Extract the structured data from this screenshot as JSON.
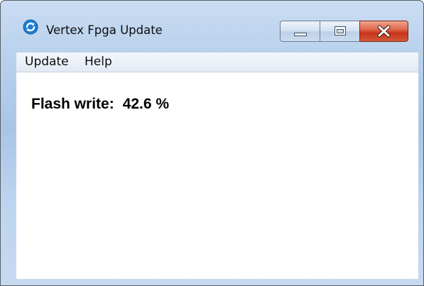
{
  "window": {
    "title": "Vertex Fpga Update",
    "icon": "refresh-circle-icon",
    "controls": {
      "minimize": "minimize-icon",
      "maximize": "maximize-icon",
      "close": "close-icon"
    }
  },
  "menu": {
    "items": [
      {
        "label": "Update"
      },
      {
        "label": "Help"
      }
    ]
  },
  "status": {
    "label": "Flash write:",
    "value": "42.6 %",
    "progress_percent": 42.6
  },
  "colors": {
    "titlebar": "#b9d1ec",
    "close_button": "#c7341a",
    "menubar": "#e3eaf5",
    "client_background": "#ffffff",
    "app_icon": "#1a7fd4"
  }
}
